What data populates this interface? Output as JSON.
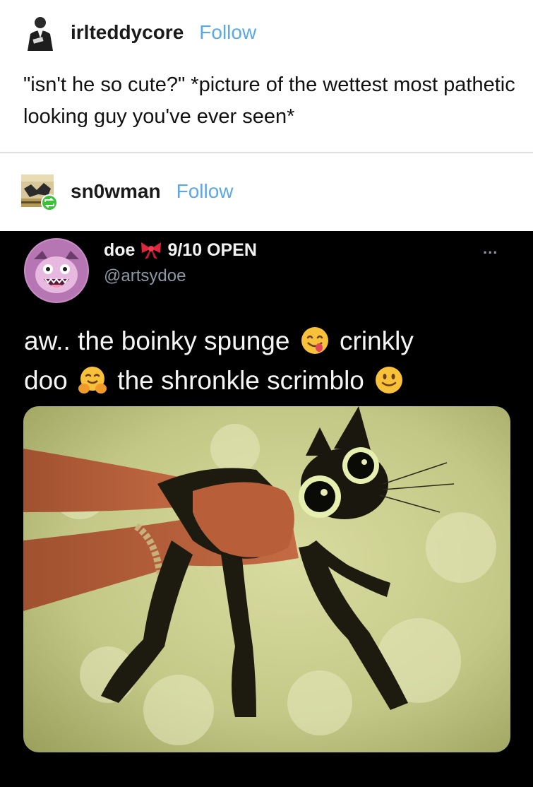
{
  "original_post": {
    "username": "irlteddycore",
    "follow_label": "Follow",
    "text": "\"isn't he so cute?\" *picture of the wettest most pathetic looking guy you've ever seen*"
  },
  "reblog": {
    "username": "sn0wman",
    "follow_label": "Follow"
  },
  "tweet": {
    "display_name": "doe",
    "name_suffix": "9/10 OPEN",
    "handle": "@artsydoe",
    "more_label": "...",
    "text_part1": "aw.. the boinky spunge",
    "text_part2": "crinkly",
    "text_part3": "doo",
    "text_part4": "the shronkle scrimblo",
    "emojis": [
      "yum-face-icon",
      "hugging-face-icon",
      "smiling-face-icon"
    ],
    "bow_emoji": "ribbon-icon"
  },
  "colors": {
    "follow": "#5aa9e6",
    "tweet_bg": "#000000",
    "handle": "#8b98a5",
    "reblog_badge": "#3cc13b"
  }
}
